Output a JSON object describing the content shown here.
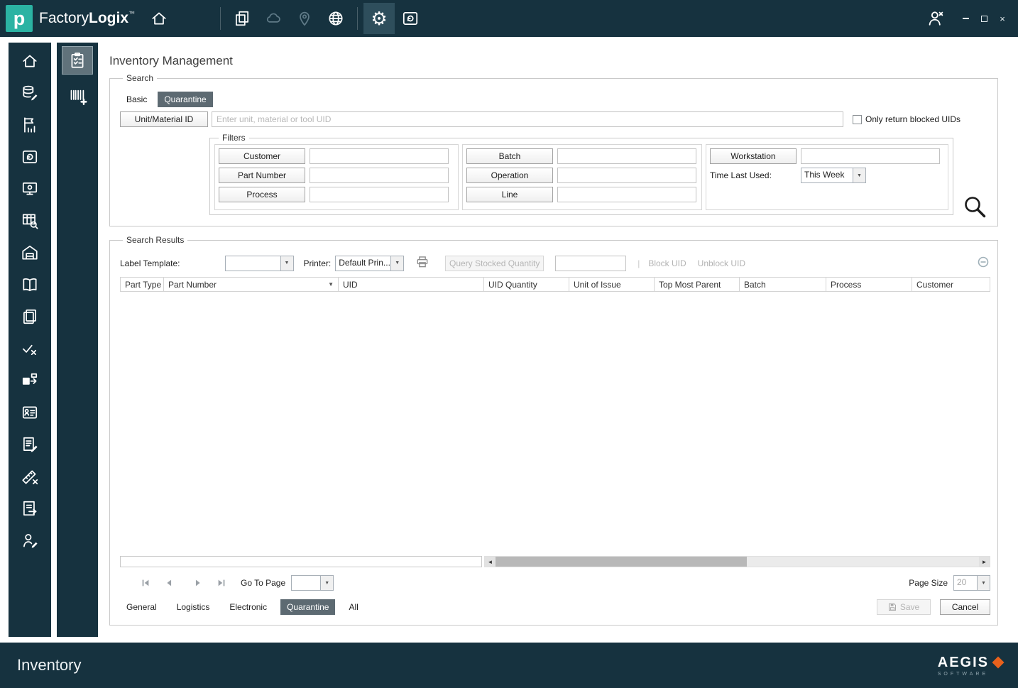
{
  "app": {
    "logo_letter": "p",
    "brand_regular": "Factory",
    "brand_bold": "Logix",
    "trademark": "™",
    "close_glyph": "×"
  },
  "page": {
    "title": "Inventory Management"
  },
  "search": {
    "legend": "Search",
    "tabs": [
      {
        "label": "Basic"
      },
      {
        "label": "Quarantine"
      }
    ],
    "unit_button": "Unit/Material ID",
    "unit_placeholder": "Enter unit, material or tool UID",
    "blocked_label": "Only return blocked UIDs",
    "filters": {
      "legend": "Filters",
      "col1": [
        "Customer",
        "Part Number",
        "Process"
      ],
      "col2": [
        "Batch",
        "Operation",
        "Line"
      ],
      "workstation": "Workstation",
      "time_label": "Time Last Used:",
      "time_value": "This Week"
    }
  },
  "results": {
    "legend": "Search Results",
    "label_template": "Label Template:",
    "printer": "Printer:",
    "printer_value": "Default Prin...",
    "query_button": "Query Stocked Quantity",
    "separator": "|",
    "block_uid": "Block UID",
    "unblock_uid": "Unblock UID",
    "columns": [
      "Part Type",
      "Part Number",
      "UID",
      "UID Quantity",
      "Unit of Issue",
      "Top Most Parent",
      "Batch",
      "Process",
      "Customer"
    ],
    "go_to_page": "Go To Page",
    "page_size_label": "Page Size",
    "page_size_value": "20",
    "tabs": [
      "General",
      "Logistics",
      "Electronic",
      "Quarantine",
      "All"
    ],
    "save": "Save",
    "cancel": "Cancel"
  },
  "glyphs": {
    "dropdown": "▼",
    "sort": "▼",
    "gear": "⚙",
    "scroll_left": "◄",
    "scroll_right": "►"
  },
  "footer": {
    "title": "Inventory",
    "brand": "AEGIS",
    "brand_sub": "SOFTWARE"
  },
  "colors": {
    "chrome": "#16323f",
    "accent_teal": "#2bb3a3",
    "selected_tab": "#5d6a72",
    "disabled_text": "#b5b5b5",
    "aegis_orange": "#e8611c"
  }
}
